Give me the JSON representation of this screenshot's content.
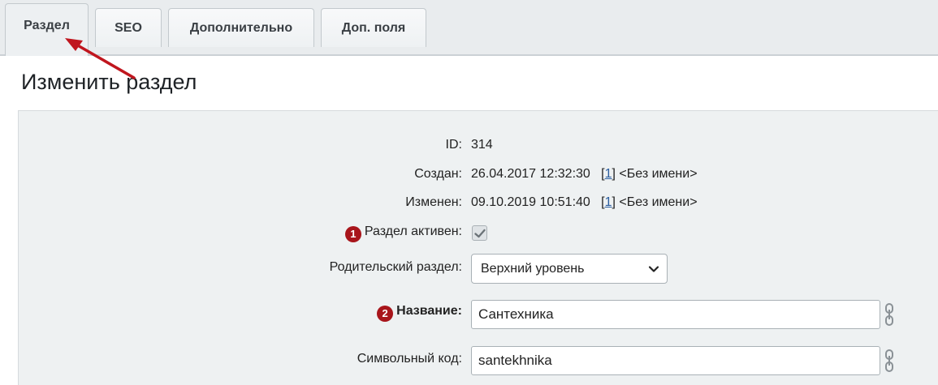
{
  "tabs": [
    {
      "label": "Раздел",
      "active": true
    },
    {
      "label": "SEO",
      "active": false
    },
    {
      "label": "Дополнительно",
      "active": false
    },
    {
      "label": "Доп. поля",
      "active": false
    }
  ],
  "page_title": "Изменить раздел",
  "fields": {
    "id": {
      "label": "ID:",
      "value": "314"
    },
    "created": {
      "label": "Создан:",
      "date": "26.04.2017 12:32:30",
      "user_prefix": "[",
      "user_id": "1",
      "user_suffix": "]",
      "user_name": "<Без имени>"
    },
    "modified": {
      "label": "Изменен:",
      "date": "09.10.2019 10:51:40",
      "user_prefix": "[",
      "user_id": "1",
      "user_suffix": "]",
      "user_name": "<Без имени>"
    },
    "active": {
      "badge": "1",
      "label": "Раздел активен:",
      "checked": true
    },
    "parent": {
      "label": "Родительский раздел:",
      "selected": "Верхний уровень"
    },
    "name": {
      "badge": "2",
      "label": "Название:",
      "value": "Сантехника"
    },
    "code": {
      "label": "Символьный код:",
      "value": "santekhnika"
    }
  },
  "colors": {
    "accent_arrow": "#c0161e",
    "badge": "#a8151b",
    "link": "#2a5d9f",
    "panel_bg": "#eef1f2"
  },
  "icons": {
    "chevron": "chevron-down-icon",
    "link": "chain-link-icon",
    "check": "checkmark-icon",
    "arrow": "annotation-arrow-icon"
  }
}
